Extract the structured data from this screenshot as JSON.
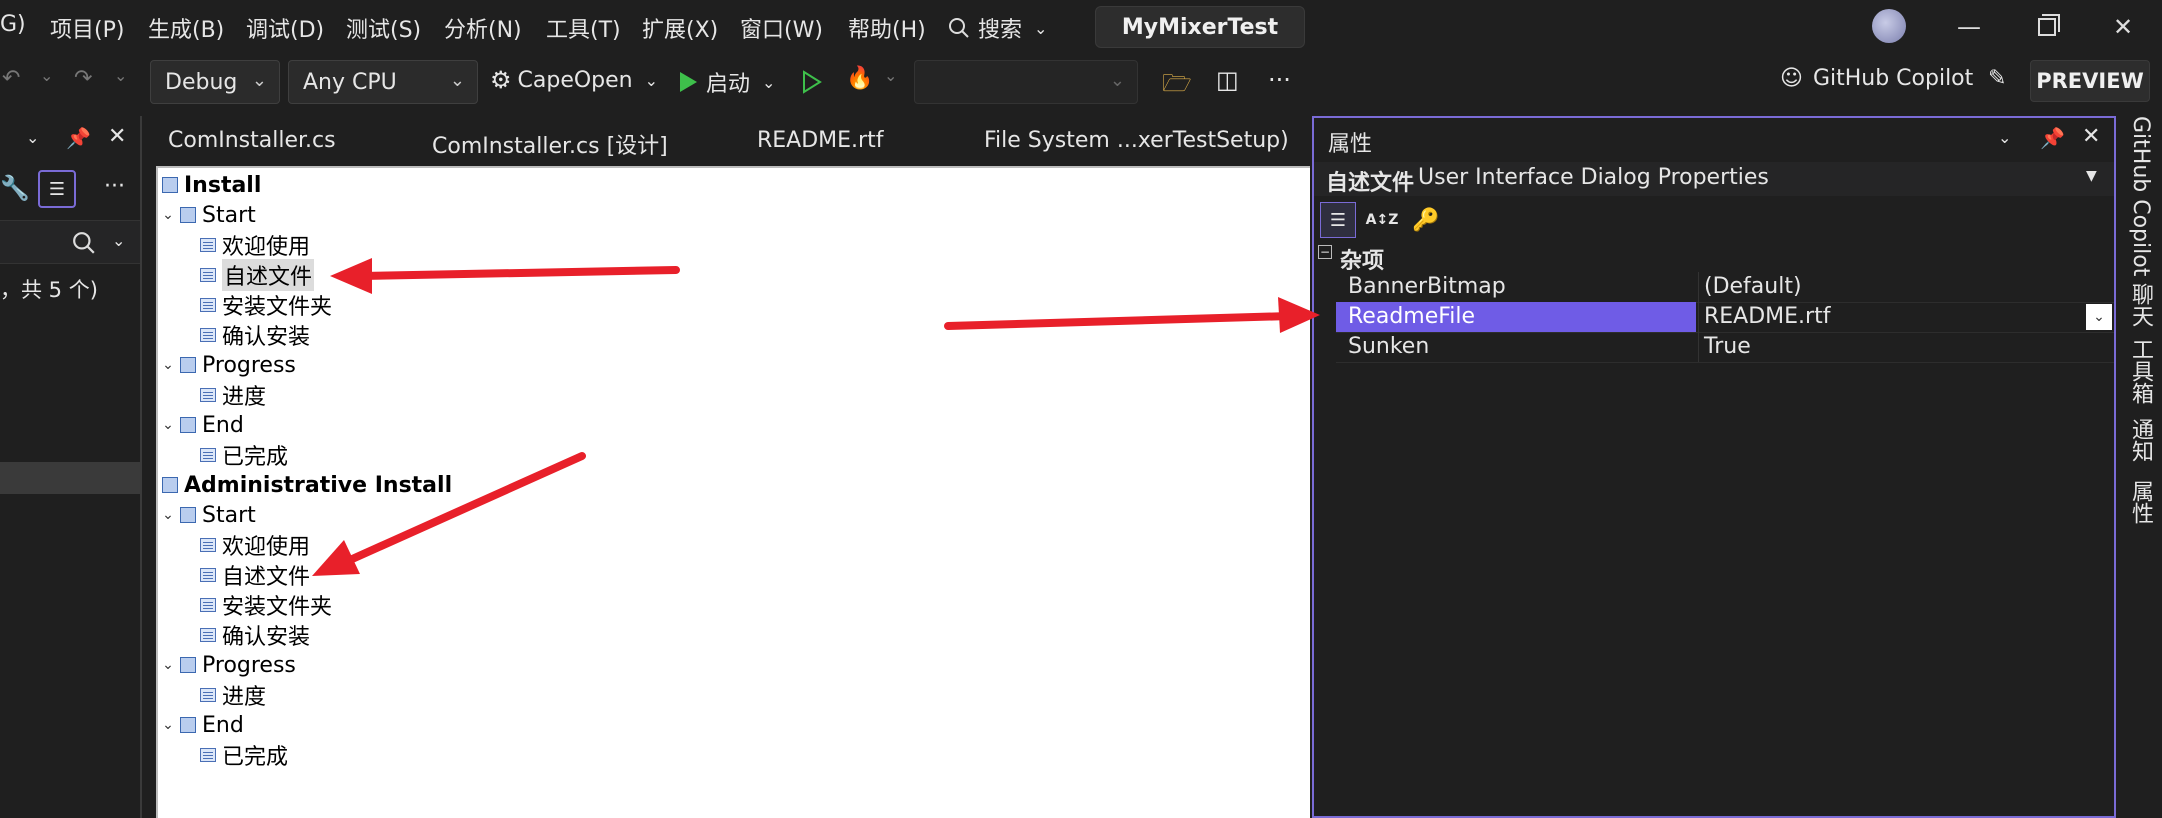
{
  "menubar": {
    "items": [
      "G)",
      "项目(P)",
      "生成(B)",
      "调试(D)",
      "测试(S)",
      "分析(N)",
      "工具(T)",
      "扩展(X)",
      "窗口(W)",
      "帮助(H)"
    ],
    "search_label": "搜索",
    "app_title": "MyMixerTest"
  },
  "toolbar": {
    "config": "Debug",
    "platform": "Any CPU",
    "startup_project": "CapeOpen",
    "start_label": "启动",
    "copilot_label": "GitHub Copilot",
    "preview_label": "PREVIEW",
    "more": "···"
  },
  "leftpanel": {
    "count_text": "，共 5 个)",
    "more": "···"
  },
  "tabs": [
    "ComInstaller.cs",
    "ComInstaller.cs [设计]",
    "README.rtf",
    "File System ...xerTestSetup)"
  ],
  "tree": {
    "install_label": "Install",
    "admin_install_label": "Administrative Install",
    "start": "Start",
    "progress": "Progress",
    "end": "End",
    "welcome": "欢迎使用",
    "readme": "自述文件",
    "install_folder": "安装文件夹",
    "confirm": "确认安装",
    "progress_item": "进度",
    "finished": "已完成"
  },
  "properties": {
    "title": "属性",
    "object_name": "自述文件",
    "object_type": "User Interface Dialog Properties",
    "category": "杂项",
    "rows": [
      {
        "key": "BannerBitmap",
        "value": "(Default)"
      },
      {
        "key": "ReadmeFile",
        "value": "README.rtf"
      },
      {
        "key": "Sunken",
        "value": "True"
      }
    ]
  },
  "rightstrip": [
    "GitHub Copilot 聊天",
    "工具箱",
    "通知",
    "属性"
  ],
  "colors": {
    "accent": "#6f5ce6",
    "arrow": "#e8202a",
    "panel_border": "#7a6bd6"
  }
}
